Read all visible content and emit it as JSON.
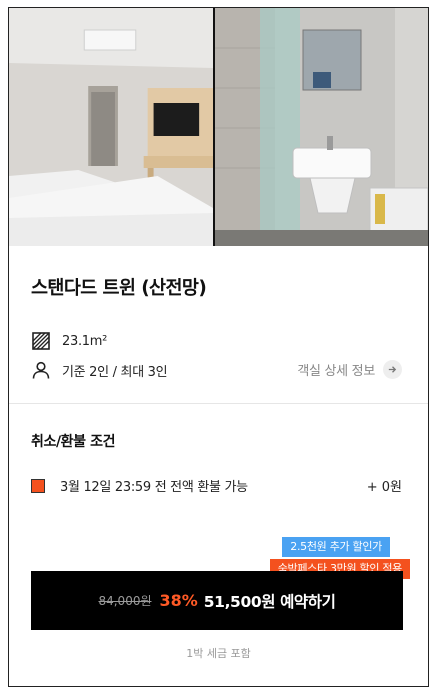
{
  "gallery": {
    "images": [
      {
        "icon": "room-photo-bedroom"
      },
      {
        "icon": "room-photo-bathroom"
      }
    ]
  },
  "room": {
    "title": "스탠다드 트윈 (산전망)",
    "size": "23.1m²",
    "capacity": "기준 2인 / 최대 3인",
    "detail_link": "객실 상세 정보"
  },
  "cancel": {
    "title": "취소/환불 조건",
    "policy": "3월 12일 23:59 전 전액 환불 가능",
    "fee": "+ 0원"
  },
  "badges": {
    "extra_discount": "2.5천원 추가 할인가",
    "festa": "숙박페스타 3만원 할인 적용"
  },
  "booking": {
    "original_price": "84,000원",
    "discount_rate": "38%",
    "cta": "51,500원 예약하기",
    "tax_note": "1박 세금 포함"
  },
  "colors": {
    "accent": "#f4511e",
    "badge_blue": "#4aa2f2",
    "button_bg": "#000000"
  }
}
